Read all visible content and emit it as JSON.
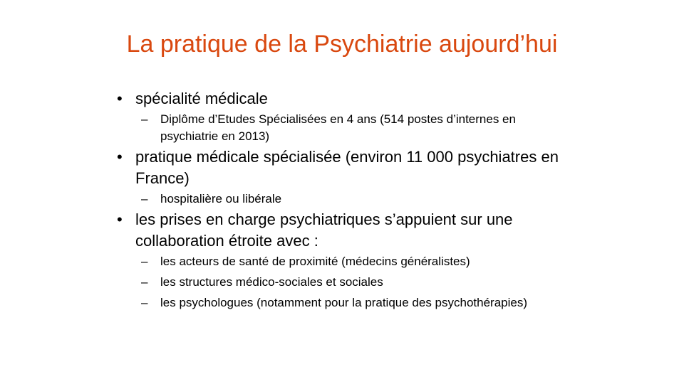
{
  "slide": {
    "title": "La pratique de la Psychiatrie aujourd’hui",
    "accent_color": "#d9480f",
    "bullet_symbol": "•",
    "sub_symbol": "–",
    "bullets": [
      {
        "text": "spécialité médicale",
        "subs": [
          "Diplôme d’Etudes Spécialisées en 4 ans (514 postes d’internes en psychiatrie en 2013)"
        ]
      },
      {
        "text": "pratique médicale spécialisée (environ 11 000 psychiatres en France)",
        "subs": [
          "hospitalière ou libérale"
        ]
      },
      {
        "text": "les prises en charge psychiatriques s’appuient sur une collaboration étroite avec :",
        "subs": [
          "les acteurs de santé de proximité (médecins généralistes)",
          "les structures médico-sociales et sociales",
          "les psychologues (notamment pour la pratique des psychothérapies)"
        ]
      }
    ]
  }
}
